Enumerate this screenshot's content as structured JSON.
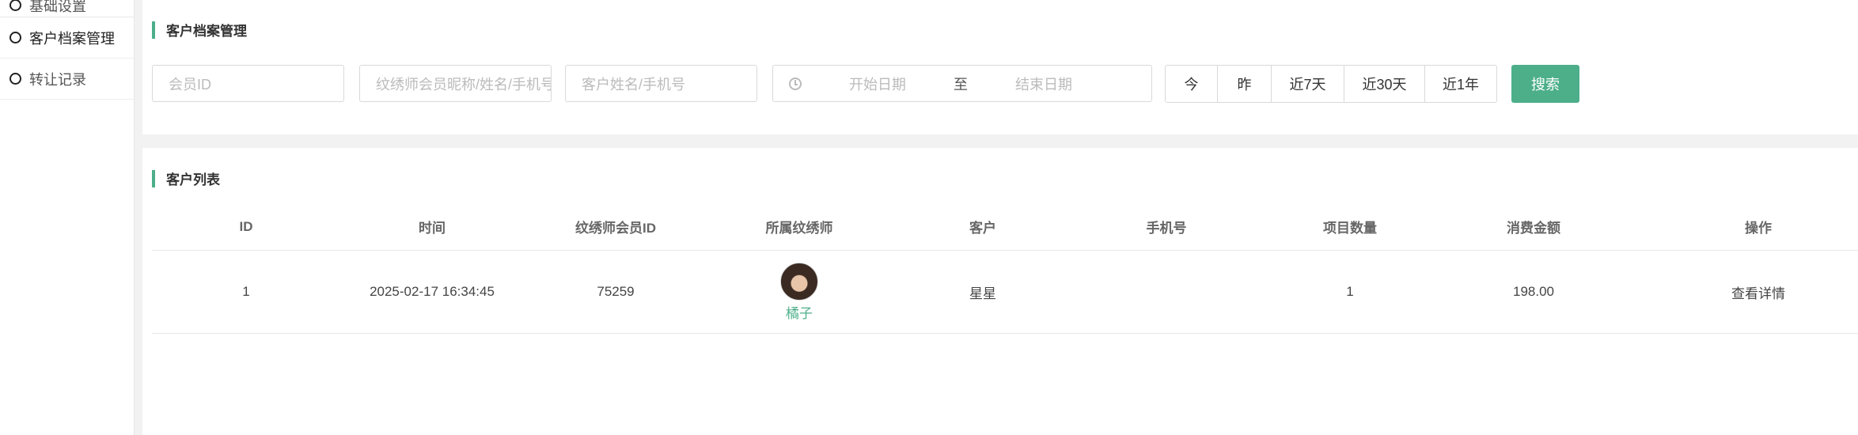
{
  "sidebar": {
    "items": [
      {
        "label": "基础设置"
      },
      {
        "label": "客户档案管理"
      },
      {
        "label": "转让记录"
      }
    ]
  },
  "filter": {
    "title": "客户档案管理",
    "member_id_placeholder": "会员ID",
    "artist_placeholder": "纹绣师会员昵称/姓名/手机号",
    "customer_placeholder": "客户姓名/手机号",
    "start_date_placeholder": "开始日期",
    "date_separator": "至",
    "end_date_placeholder": "结束日期",
    "quick_ranges": [
      "今",
      "昨",
      "近7天",
      "近30天",
      "近1年"
    ],
    "search_label": "搜索"
  },
  "list": {
    "title": "客户列表",
    "columns": [
      "ID",
      "时间",
      "纹绣师会员ID",
      "所属纹绣师",
      "客户",
      "手机号",
      "项目数量",
      "消费金额",
      "操作"
    ],
    "rows": [
      {
        "id": "1",
        "time": "2025-02-17 16:34:45",
        "artist_member_id": "75259",
        "artist_name": "橘子",
        "customer": "星星",
        "phone": "",
        "item_count": "1",
        "amount": "198.00",
        "action": "查看详情"
      }
    ]
  },
  "colors": {
    "accent": "#4caf8a"
  }
}
